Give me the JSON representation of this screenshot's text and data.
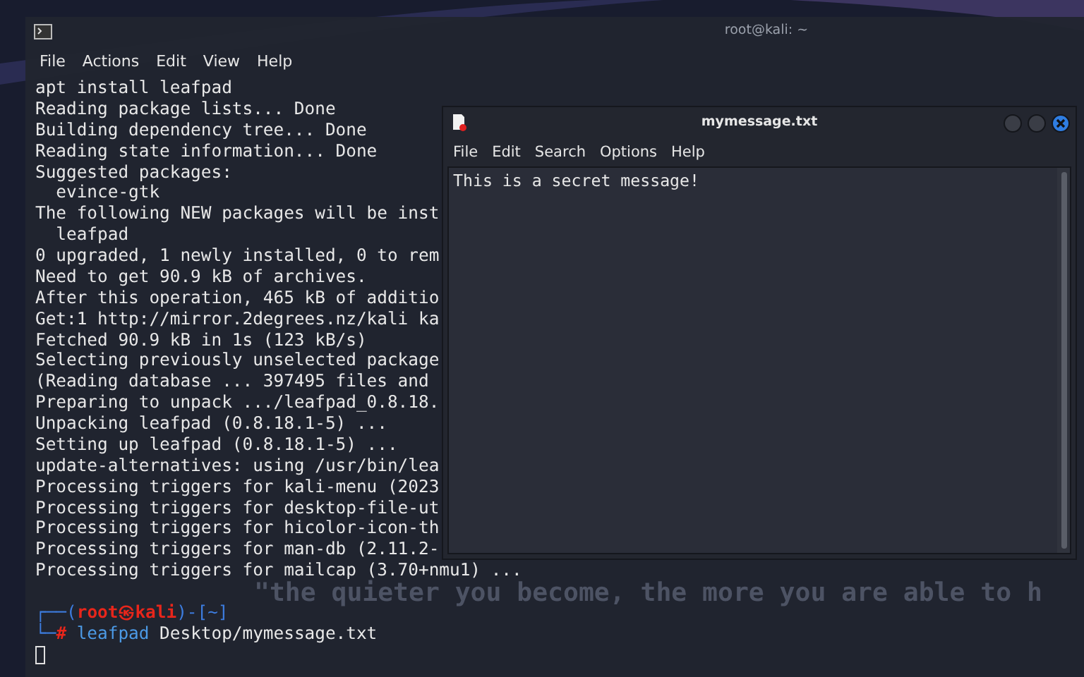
{
  "terminal": {
    "title": "root@kali: ~",
    "menu": [
      "File",
      "Actions",
      "Edit",
      "View",
      "Help"
    ],
    "lines": [
      "apt install leafpad",
      "Reading package lists... Done",
      "Building dependency tree... Done",
      "Reading state information... Done",
      "Suggested packages:",
      "  evince-gtk",
      "The following NEW packages will be inst",
      "  leafpad",
      "0 upgraded, 1 newly installed, 0 to rem",
      "Need to get 90.9 kB of archives.",
      "After this operation, 465 kB of additio",
      "Get:1 http://mirror.2degrees.nz/kali ka",
      "Fetched 90.9 kB in 1s (123 kB/s)",
      "Selecting previously unselected package",
      "(Reading database ... 397495 files and ",
      "Preparing to unpack .../leafpad_0.8.18.",
      "Unpacking leafpad (0.8.18.1-5) ...",
      "Setting up leafpad (0.8.18.1-5) ...",
      "update-alternatives: using /usr/bin/lea",
      "Processing triggers for kali-menu (2023",
      "Processing triggers for desktop-file-ut",
      "Processing triggers for hicolor-icon-th",
      "Processing triggers for man-db (2.11.2-",
      "Processing triggers for mailcap (3.70+nmu1) ..."
    ],
    "prompt": [
      [
        {
          "text": "┌──(",
          "kind": "frame"
        },
        {
          "text": "root㉿kali",
          "kind": "user"
        },
        {
          "text": ")-[",
          "kind": "frame"
        },
        {
          "text": "~",
          "kind": "frame"
        },
        {
          "text": "]",
          "kind": "frame"
        }
      ],
      [
        {
          "text": "└─",
          "kind": "frame"
        },
        {
          "text": "#",
          "kind": "user"
        },
        {
          "text": "leafpad",
          "kind": "command"
        },
        {
          "text": " Desktop/mymessage.txt",
          "kind": "plain"
        }
      ]
    ]
  },
  "wallpaper_text": "\"the quieter you become, the more you are able to h",
  "editor": {
    "title": "mymessage.txt",
    "menu": [
      "File",
      "Edit",
      "Search",
      "Options",
      "Help"
    ],
    "content": "This is a secret message!"
  }
}
